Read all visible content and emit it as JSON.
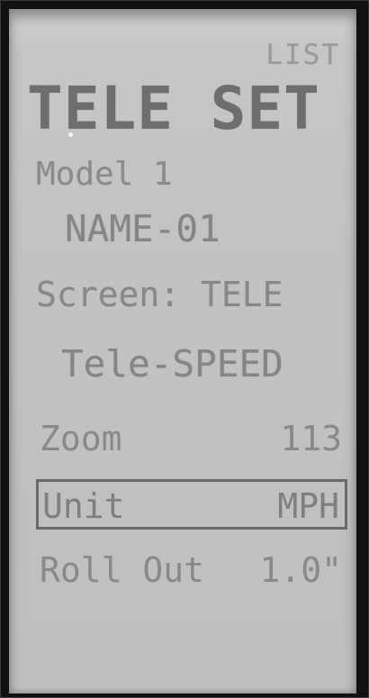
{
  "header": {
    "list_label": "LIST",
    "title": "TELE SET"
  },
  "model": {
    "label": "Model 1",
    "name": "NAME-01"
  },
  "screen_line": "Screen: TELE",
  "tele_mode": "Tele-SPEED",
  "settings": {
    "zoom": {
      "label": "Zoom",
      "value": "113"
    },
    "unit": {
      "label": "Unit",
      "value": "MPH"
    },
    "roll_out": {
      "label": "Roll Out",
      "value": "1.0\""
    }
  },
  "colors": {
    "lcd_background": "#c4c4c4",
    "lcd_text": "#888888",
    "selection_border": "#6a6a6a"
  }
}
